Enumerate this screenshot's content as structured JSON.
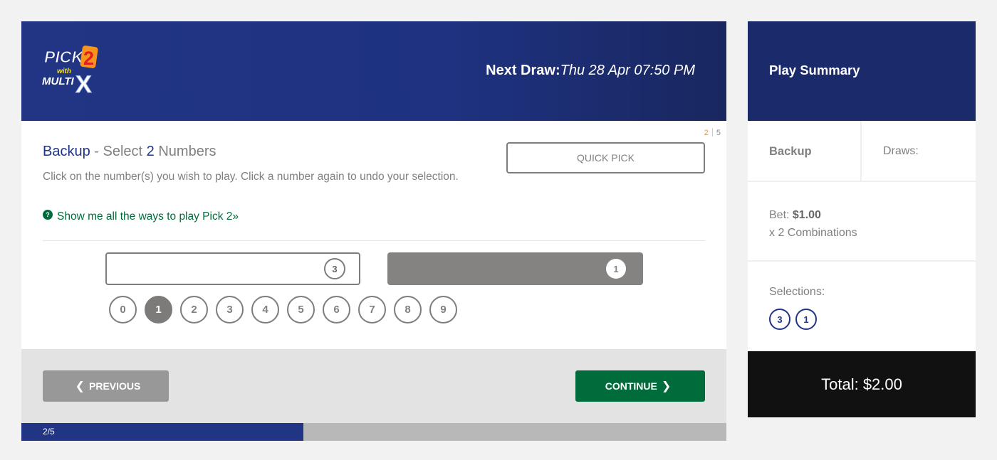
{
  "header": {
    "logo": {
      "line1": "PICK",
      "digit": "2",
      "line2": "with",
      "line3": "MULTI",
      "mark": "X"
    },
    "next_draw_label": "Next Draw:",
    "next_draw_value": "Thu 28 Apr 07:50 PM"
  },
  "step_indicator": {
    "current": "2",
    "total": "5"
  },
  "title": {
    "game": "Backup",
    "dash": " - ",
    "select": "Select",
    "count": "2",
    "numbers": "Numbers"
  },
  "instructions": "Click on the number(s) you wish to play. Click a number again to undo your selection.",
  "help": {
    "icon": "?",
    "link": "Show me all the ways to play Pick 2»"
  },
  "quick_pick_label": "QUICK PICK",
  "slots": [
    "3",
    "1"
  ],
  "number_pad": {
    "numbers": [
      "0",
      "1",
      "2",
      "3",
      "4",
      "5",
      "6",
      "7",
      "8",
      "9"
    ],
    "selected": "1"
  },
  "footer": {
    "previous_label": "PREVIOUS",
    "continue_label": "CONTINUE"
  },
  "progress": {
    "label": "2/5",
    "fraction": 0.4
  },
  "summary": {
    "title": "Play Summary",
    "game": "Backup",
    "draws_label": "Draws:",
    "bet_label": "Bet: ",
    "bet_value": "$1.00",
    "combinations": "x 2 Combinations",
    "selections_label": "Selections:",
    "selections": [
      "3",
      "1"
    ],
    "total": "Total: $2.00"
  },
  "colors": {
    "brand_blue": "#223585",
    "continue_green": "#006c3b",
    "selected_gray": "#7d7a7a",
    "accent_orange": "#f7941d"
  }
}
